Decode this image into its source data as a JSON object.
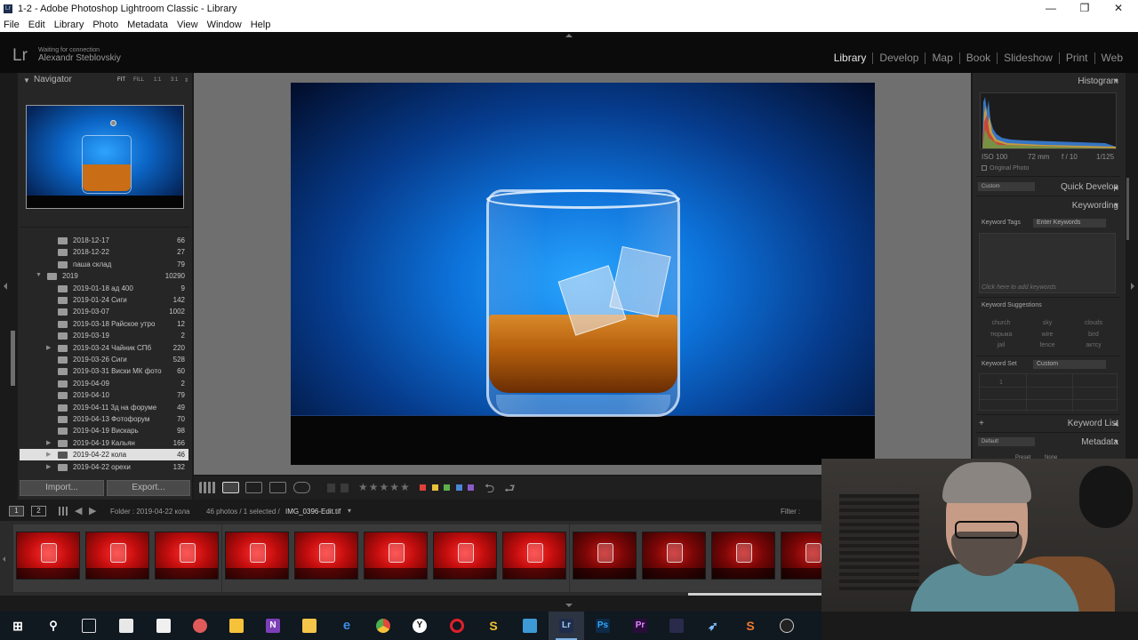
{
  "window": {
    "title": "1-2 - Adobe Photoshop Lightroom Classic - Library",
    "app_icon": "Lr",
    "controls": [
      "—",
      "❐",
      "✕"
    ]
  },
  "menu": [
    "File",
    "Edit",
    "Library",
    "Photo",
    "Metadata",
    "View",
    "Window",
    "Help"
  ],
  "identity": {
    "logo": "Lr",
    "status": "Waiting for connection",
    "user": "Alexandr Steblovskiy"
  },
  "modules": [
    "Library",
    "Develop",
    "Map",
    "Book",
    "Slideshow",
    "Print",
    "Web"
  ],
  "active_module": "Library",
  "navigator": {
    "title": "Navigator",
    "zoom_options": [
      "FIT",
      "FILL",
      "1:1",
      "3:1",
      "⇕"
    ]
  },
  "folders": [
    {
      "name": "2018-12-17",
      "count": "66",
      "level": 1
    },
    {
      "name": "2018-12-22",
      "count": "27",
      "level": 1
    },
    {
      "name": "паша склад",
      "count": "79",
      "level": 1
    },
    {
      "name": "2019",
      "count": "10290",
      "level": 0,
      "expanded": true
    },
    {
      "name": "2019-01-18 ад 400",
      "count": "9",
      "level": 1
    },
    {
      "name": "2019-01-24 Сиги",
      "count": "142",
      "level": 1
    },
    {
      "name": "2019-03-07",
      "count": "1002",
      "level": 1
    },
    {
      "name": "2019-03-18 Райское утро",
      "count": "12",
      "level": 1
    },
    {
      "name": "2019-03-19",
      "count": "2",
      "level": 1
    },
    {
      "name": "2019-03-24 Чайник СПб",
      "count": "220",
      "level": 1,
      "collapsed": true
    },
    {
      "name": "2019-03-26 Сиги",
      "count": "528",
      "level": 1
    },
    {
      "name": "2019-03-31 Виски МК фото",
      "count": "60",
      "level": 1
    },
    {
      "name": "2019-04-09",
      "count": "2",
      "level": 1
    },
    {
      "name": "2019-04-10",
      "count": "79",
      "level": 1
    },
    {
      "name": "2019-04-11 3д на форуме",
      "count": "49",
      "level": 1
    },
    {
      "name": "2019-04-13 Фотофорум",
      "count": "70",
      "level": 1
    },
    {
      "name": "2019-04-19 Вискарь",
      "count": "98",
      "level": 1
    },
    {
      "name": "2019-04-19 Кальян",
      "count": "166",
      "level": 1,
      "collapsed": true
    },
    {
      "name": "2019-04-22 кола",
      "count": "46",
      "level": 1,
      "collapsed": true,
      "selected": true
    },
    {
      "name": "2019-04-22 орехи",
      "count": "132",
      "level": 1,
      "collapsed": true
    }
  ],
  "buttons": {
    "import": "Import...",
    "export": "Export..."
  },
  "toolbar": {
    "stars": "★★★★★",
    "colors": [
      "#e0403a",
      "#e8c23a",
      "#5db04a",
      "#4a86d6",
      "#8a5ac8"
    ]
  },
  "filmstrip_header": {
    "page1": "1",
    "page2": "2",
    "folder_label": "Folder : 2019-04-22 кола",
    "summary": "46 photos / 1 selected /",
    "filename": "IMG_0396-Edit.tif",
    "filter": "Filter :"
  },
  "thumbnails": [
    {
      "style": "bright"
    },
    {
      "style": "bright"
    },
    {
      "style": "bright"
    },
    {
      "style": "bright"
    },
    {
      "style": "bright"
    },
    {
      "style": "bright"
    },
    {
      "style": "bright"
    },
    {
      "style": "bright"
    },
    {
      "style": "dark"
    },
    {
      "style": "dark"
    },
    {
      "style": "dark"
    },
    {
      "style": "dark"
    }
  ],
  "right_panel": {
    "histogram": "Histogram",
    "iso": "ISO 100",
    "focal": "72 mm",
    "aperture": "f / 10",
    "shutter": "1/125",
    "original_photo": "Original Photo",
    "qd_preset": "Custom",
    "quick_develop": "Quick Develop",
    "keywording": "Keywording",
    "keyword_tags": "Keyword Tags",
    "enter_keywords": "Enter Keywords",
    "add_hint": "Click here to add keywords",
    "keyword_suggestions": "Keyword Suggestions",
    "suggestions": [
      "church",
      "sky",
      "clouds",
      "тюрьма",
      "wire",
      "bird",
      "jail",
      "fence",
      "актсу"
    ],
    "keyword_set": "Keyword Set",
    "keyword_set_value": "Custom",
    "set_cell_1": "1",
    "keyword_list": "Keyword List",
    "metadata_preset": "Default",
    "metadata": "Metadata",
    "preset_label": "Preset",
    "preset_value": "None"
  }
}
